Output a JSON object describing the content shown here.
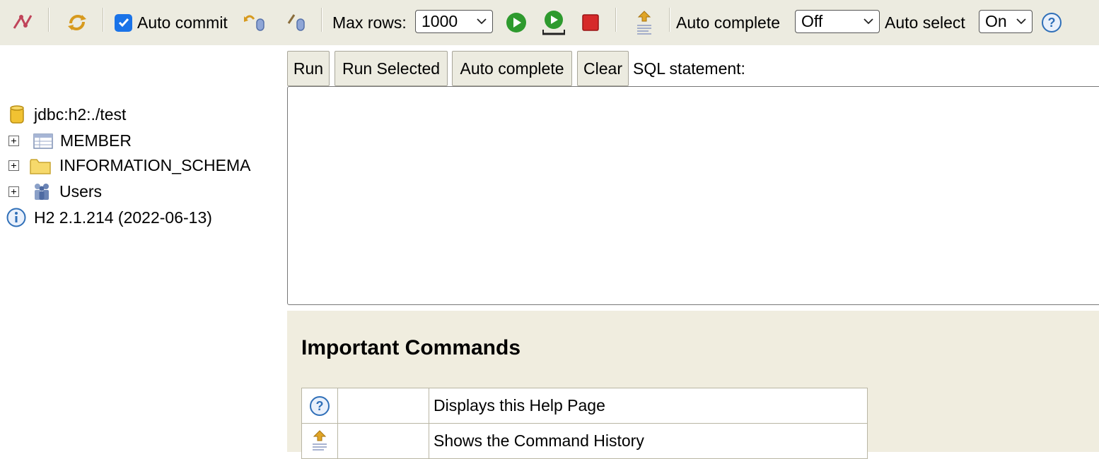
{
  "toolbar": {
    "disconnect_icon": "disconnect-icon",
    "refresh_icon": "refresh-icon",
    "auto_commit_label": "Auto commit",
    "auto_commit_checked": true,
    "rollback_icon": "rollback-icon",
    "commit_icon": "commit-icon",
    "max_rows_label": "Max rows:",
    "max_rows_value": "1000",
    "auto_complete_label": "Auto complete",
    "auto_complete_value": "Off",
    "auto_select_label": "Auto select",
    "auto_select_value": "On",
    "colors": {
      "run": "#2e9a2e",
      "stop": "#d62a2a",
      "help": "#2f6fb8"
    }
  },
  "tree": {
    "connection": "jdbc:h2:./test",
    "items": [
      {
        "label": "MEMBER",
        "icon": "table-icon"
      },
      {
        "label": "INFORMATION_SCHEMA",
        "icon": "folder-icon"
      },
      {
        "label": "Users",
        "icon": "users-icon"
      }
    ],
    "version": "H2 2.1.214 (2022-06-13)"
  },
  "sql": {
    "run_label": "Run",
    "run_selected_label": "Run Selected",
    "auto_complete_label": "Auto complete",
    "clear_label": "Clear",
    "statement_label": "SQL statement:",
    "statement_value": ""
  },
  "help": {
    "title": "Important Commands",
    "rows": [
      {
        "icon": "help-icon",
        "shortcut": "",
        "description": "Displays this Help Page"
      },
      {
        "icon": "history-icon",
        "shortcut": "",
        "description": "Shows the Command History"
      }
    ]
  }
}
